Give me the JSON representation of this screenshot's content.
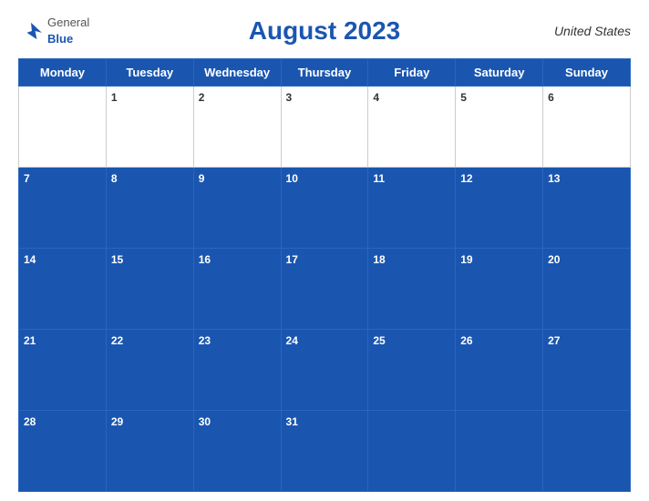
{
  "header": {
    "logo": {
      "general": "General",
      "blue": "Blue"
    },
    "title": "August 2023",
    "country": "United States"
  },
  "calendar": {
    "weekdays": [
      "Monday",
      "Tuesday",
      "Wednesday",
      "Thursday",
      "Friday",
      "Saturday",
      "Sunday"
    ],
    "weeks": [
      [
        null,
        "1",
        "2",
        "3",
        "4",
        "5",
        "6"
      ],
      [
        "7",
        "8",
        "9",
        "10",
        "11",
        "12",
        "13"
      ],
      [
        "14",
        "15",
        "16",
        "17",
        "18",
        "19",
        "20"
      ],
      [
        "21",
        "22",
        "23",
        "24",
        "25",
        "26",
        "27"
      ],
      [
        "28",
        "29",
        "30",
        "31",
        null,
        null,
        null
      ]
    ]
  }
}
